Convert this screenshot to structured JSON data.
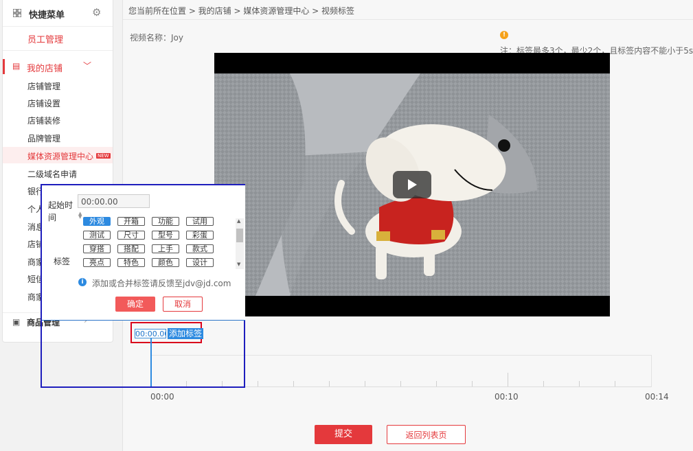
{
  "sidebar": {
    "title": "快捷菜单",
    "staff": "员工管理",
    "shop_section": "我的店铺",
    "items": [
      "店铺管理",
      "店铺设置",
      "店铺装修",
      "品牌管理",
      "媒体资源管理中心",
      "二级域名申请",
      "银行",
      "个人",
      "消息",
      "店铺",
      "商家",
      "短信",
      "商家"
    ],
    "new_badge": "NEW",
    "goods_section": "商品管理"
  },
  "breadcrumb": "您当前所在位置 > 我的店铺 > 媒体资源管理中心 > 视频标签",
  "video": {
    "name_label": "视频名称：Joy",
    "note": "注：标签最多3个，最少2个，且标签内容不能小于5s"
  },
  "tag_row": {
    "time": "00:00.00",
    "add_label": "添加标签"
  },
  "timeline": {
    "labels": [
      "00:00",
      "00:10",
      "00:14"
    ]
  },
  "actions": {
    "submit": "提交",
    "back": "返回列表页"
  },
  "popup": {
    "start_label": "起始时间",
    "start_value": "00:00.00",
    "tag_label": "标签",
    "tags": [
      "外观",
      "开箱",
      "功能",
      "试用",
      "测试",
      "尺寸",
      "型号",
      "彩蛋",
      "穿搭",
      "搭配",
      "上手",
      "款式",
      "亮点",
      "特色",
      "颜色",
      "设计"
    ],
    "selected_tag": "外观",
    "info": "添加或合并标签请反馈至jdv@jd.com",
    "ok": "确定",
    "cancel": "取消"
  },
  "colors": {
    "accent_red": "#e4393c",
    "accent_blue": "#2d8ae0",
    "warn_orange": "#f6a21a"
  }
}
